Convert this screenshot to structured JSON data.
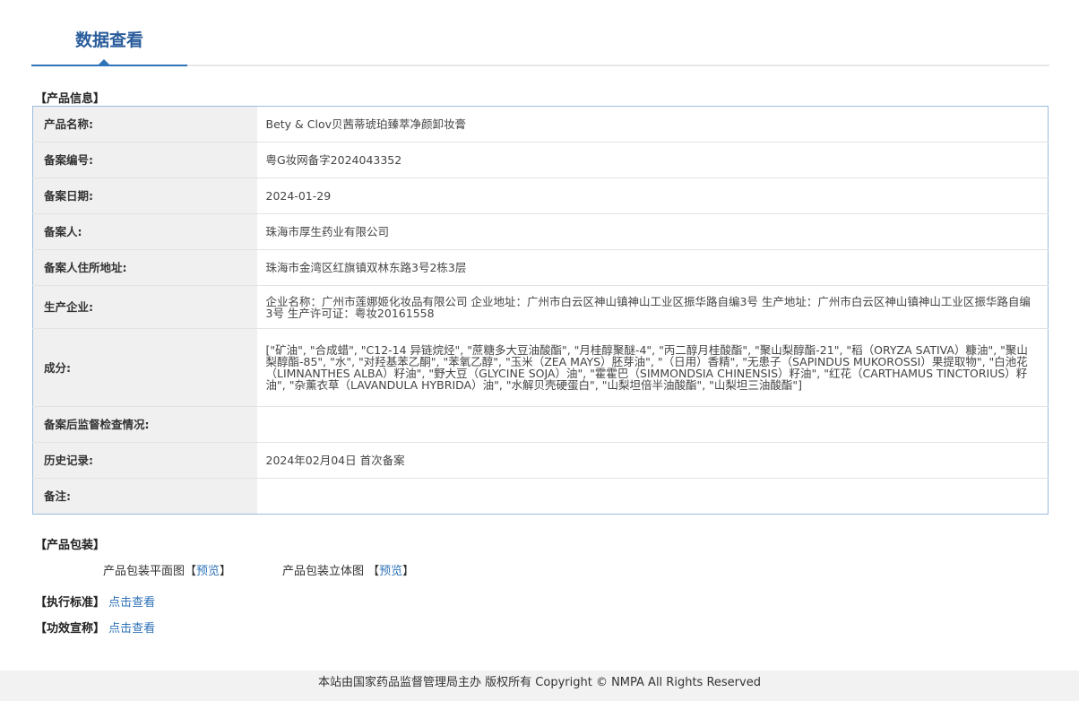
{
  "header": {
    "tab_label": "数据查看"
  },
  "product_info": {
    "section_title": "【产品信息】",
    "rows": [
      {
        "key": "产品名称:",
        "value": "Bety & Clov贝茜蒂琥珀臻萃净颜卸妆膏"
      },
      {
        "key": "备案编号:",
        "value": "粤G妆网备字2024043352"
      },
      {
        "key": "备案日期:",
        "value": "2024-01-29"
      },
      {
        "key": "备案人:",
        "value": "珠海市厚生药业有限公司"
      },
      {
        "key": "备案人住所地址:",
        "value": "珠海市金湾区红旗镇双林东路3号2栋3层"
      },
      {
        "key": "生产企业:",
        "value": "企业名称：广州市莲娜姬化妆品有限公司 企业地址：广州市白云区神山镇神山工业区振华路自编3号 生产地址：广州市白云区神山镇神山工业区振华路自编3号 生产许可证：粤妆20161558"
      },
      {
        "key": "成分:",
        "value": "[\"矿油\", \"合成蜡\", \"C12-14 异链烷烃\", \"蔗糖多大豆油酸酯\", \"月桂醇聚醚-4\", \"丙二醇月桂酸酯\", \"聚山梨醇酯-21\", \"稻（ORYZA SATIVA）糠油\", \"聚山梨醇酯-85\", \"水\", \"对羟基苯乙酮\", \"苯氧乙醇\", \"玉米（ZEA MAYS）胚芽油\", \"（日用）香精\", \"无患子（SAPINDUS MUKOROSSI）果提取物\", \"白池花（LIMNANTHES ALBA）籽油\", \"野大豆（GLYCINE SOJA）油\", \"霍霍巴（SIMMONDSIA CHINENSIS）籽油\", \"红花（CARTHAMUS TINCTORIUS）籽油\", \"杂薰衣草（LAVANDULA HYBRIDA）油\", \"水解贝壳硬蛋白\", \"山梨坦倍半油酸酯\", \"山梨坦三油酸酯\"]"
      },
      {
        "key": "备案后监督检查情况:",
        "value": ""
      },
      {
        "key": "历史记录:",
        "value": "2024年02月04日 首次备案"
      },
      {
        "key": "备注:",
        "value": ""
      }
    ]
  },
  "packaging": {
    "section_title": "【产品包装】",
    "flat_label": "产品包装平面图【",
    "flat_link": "预览",
    "flat_close": "】",
    "three_d_label": "产品包装立体图 【",
    "three_d_link": "预览",
    "three_d_close": "】"
  },
  "standard": {
    "label": "【执行标准】",
    "link": "点击查看"
  },
  "efficacy": {
    "label": "【功效宣称】",
    "link": "点击查看"
  },
  "footer": {
    "text": "本站由国家药品监督管理局主办 版权所有 Copyright © NMPA All Rights Reserved"
  },
  "colors": {
    "accent": "#2f73b8",
    "tab_text": "#2a5d9c",
    "table_border": "#9bbbe0",
    "key_bg": "#f0f0f0"
  }
}
